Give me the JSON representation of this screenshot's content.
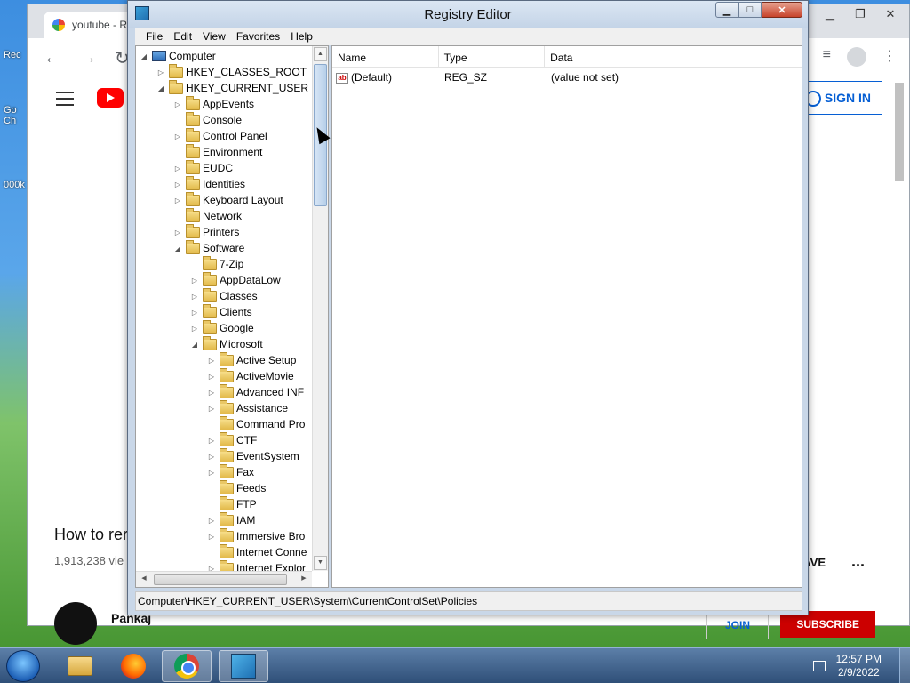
{
  "browser": {
    "tab_title": "youtube - R",
    "yt_signin": "SIGN IN",
    "video_title": "How to rer",
    "views": "1,913,238 vie",
    "save_label": "AVE",
    "more": "...",
    "channel": "Pankaj",
    "join": "JOIN",
    "subscribe": "SUBSCRIBE"
  },
  "desktop": {
    "icons": [
      "Rec",
      "Go Ch",
      "000k"
    ]
  },
  "regedit": {
    "title": "Registry Editor",
    "window_controls": {
      "minimize": "▁",
      "maximize": "□",
      "close": "✕"
    },
    "menu": [
      "File",
      "Edit",
      "View",
      "Favorites",
      "Help"
    ],
    "tree": [
      {
        "label": "Computer",
        "exp": "◢"
      },
      {
        "label": "HKEY_CLASSES_ROOT",
        "exp": "▷"
      },
      {
        "label": "HKEY_CURRENT_USER",
        "exp": "◢"
      },
      {
        "label": "AppEvents",
        "exp": "▷"
      },
      {
        "label": "Console",
        "exp": ""
      },
      {
        "label": "Control Panel",
        "exp": "▷"
      },
      {
        "label": "Environment",
        "exp": ""
      },
      {
        "label": "EUDC",
        "exp": "▷"
      },
      {
        "label": "Identities",
        "exp": "▷"
      },
      {
        "label": "Keyboard Layout",
        "exp": "▷"
      },
      {
        "label": "Network",
        "exp": ""
      },
      {
        "label": "Printers",
        "exp": "▷"
      },
      {
        "label": "Software",
        "exp": "◢"
      },
      {
        "label": "7-Zip",
        "exp": ""
      },
      {
        "label": "AppDataLow",
        "exp": "▷"
      },
      {
        "label": "Classes",
        "exp": "▷"
      },
      {
        "label": "Clients",
        "exp": "▷"
      },
      {
        "label": "Google",
        "exp": "▷"
      },
      {
        "label": "Microsoft",
        "exp": "◢"
      },
      {
        "label": "Active Setup",
        "exp": "▷"
      },
      {
        "label": "ActiveMovie",
        "exp": "▷"
      },
      {
        "label": "Advanced INF",
        "exp": "▷"
      },
      {
        "label": "Assistance",
        "exp": "▷"
      },
      {
        "label": "Command Pro",
        "exp": ""
      },
      {
        "label": "CTF",
        "exp": "▷"
      },
      {
        "label": "EventSystem",
        "exp": "▷"
      },
      {
        "label": "Fax",
        "exp": "▷"
      },
      {
        "label": "Feeds",
        "exp": ""
      },
      {
        "label": "FTP",
        "exp": ""
      },
      {
        "label": "IAM",
        "exp": "▷"
      },
      {
        "label": "Immersive Bro",
        "exp": "▷"
      },
      {
        "label": "Internet Conne",
        "exp": ""
      },
      {
        "label": "Internet Explor",
        "exp": "▷"
      }
    ],
    "columns": [
      "Name",
      "Type",
      "Data"
    ],
    "values": [
      {
        "name": "(Default)",
        "type": "REG_SZ",
        "data": "(value not set)"
      }
    ],
    "status_path": "Computer\\HKEY_CURRENT_USER\\System\\CurrentControlSet\\Policies"
  },
  "taskbar": {
    "apps": [
      "windows-explorer",
      "firefox",
      "chrome",
      "registry-editor"
    ],
    "time": "12:57 PM",
    "date": "2/9/2022"
  }
}
